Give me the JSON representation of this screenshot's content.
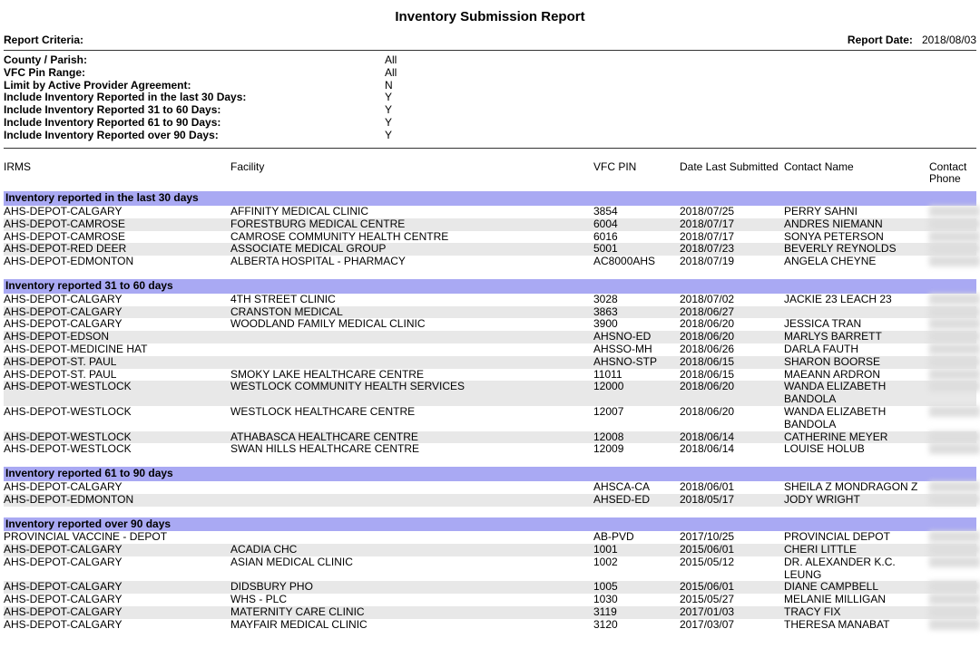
{
  "title": "Inventory Submission Report",
  "report_criteria_label": "Report Criteria:",
  "report_date_label": "Report Date:",
  "report_date": "2018/08/03",
  "criteria": [
    {
      "label": "County / Parish:",
      "value": "All"
    },
    {
      "label": "VFC Pin Range:",
      "value": "All"
    },
    {
      "label": "Limit by Active Provider Agreement:",
      "value": "N"
    },
    {
      "label": "Include Inventory Reported in the last 30 Days:",
      "value": "Y"
    },
    {
      "label": "Include Inventory Reported 31 to 60 Days:",
      "value": "Y"
    },
    {
      "label": "Include Inventory Reported 61 to 90 Days:",
      "value": "Y"
    },
    {
      "label": "Include Inventory Reported over 90 Days:",
      "value": "Y"
    }
  ],
  "columns": {
    "irms": "IRMS",
    "facility": "Facility",
    "vfc_pin": "VFC PIN",
    "date_last": "Date Last Submitted",
    "contact_name": "Contact Name",
    "contact_phone": "Contact Phone"
  },
  "groups": [
    {
      "header": "Inventory reported in the last 30 days",
      "rows": [
        {
          "irms": "AHS-DEPOT-CALGARY",
          "facility": "AFFINITY MEDICAL CLINIC",
          "pin": "3854",
          "date": "2018/07/25",
          "contact": "PERRY SAHNI"
        },
        {
          "irms": "AHS-DEPOT-CAMROSE",
          "facility": "FORESTBURG MEDICAL CENTRE",
          "pin": "6004",
          "date": "2018/07/17",
          "contact": "ANDRES NIEMANN"
        },
        {
          "irms": "AHS-DEPOT-CAMROSE",
          "facility": "CAMROSE COMMUNITY HEALTH CENTRE",
          "pin": "6016",
          "date": "2018/07/17",
          "contact": "SONYA PETERSON"
        },
        {
          "irms": "AHS-DEPOT-RED DEER",
          "facility": "ASSOCIATE MEDICAL GROUP",
          "pin": "5001",
          "date": "2018/07/23",
          "contact": "BEVERLY REYNOLDS"
        },
        {
          "irms": "AHS-DEPOT-EDMONTON",
          "facility": "ALBERTA HOSPITAL - PHARMACY",
          "pin": "AC8000AHS",
          "date": "2018/07/19",
          "contact": "ANGELA CHEYNE"
        }
      ]
    },
    {
      "header": "Inventory reported 31 to 60 days",
      "rows": [
        {
          "irms": "AHS-DEPOT-CALGARY",
          "facility": "4TH STREET CLINIC",
          "pin": "3028",
          "date": "2018/07/02",
          "contact": "JACKIE 23 LEACH 23"
        },
        {
          "irms": "AHS-DEPOT-CALGARY",
          "facility": "CRANSTON MEDICAL",
          "pin": "3863",
          "date": "2018/06/27",
          "contact": ""
        },
        {
          "irms": "AHS-DEPOT-CALGARY",
          "facility": "WOODLAND FAMILY MEDICAL CLINIC",
          "pin": "3900",
          "date": "2018/06/20",
          "contact": "JESSICA TRAN"
        },
        {
          "irms": "AHS-DEPOT-EDSON",
          "facility": "",
          "pin": "AHSNO-ED",
          "date": "2018/06/20",
          "contact": "MARLYS BARRETT"
        },
        {
          "irms": "AHS-DEPOT-MEDICINE HAT",
          "facility": "",
          "pin": "AHSSO-MH",
          "date": "2018/06/26",
          "contact": "DARLA FAUTH"
        },
        {
          "irms": "AHS-DEPOT-ST. PAUL",
          "facility": "",
          "pin": "AHSNO-STP",
          "date": "2018/06/15",
          "contact": "SHARON BOORSE"
        },
        {
          "irms": "AHS-DEPOT-ST. PAUL",
          "facility": "SMOKY LAKE HEALTHCARE CENTRE",
          "pin": "11011",
          "date": "2018/06/15",
          "contact": "MAEANN ARDRON"
        },
        {
          "irms": "AHS-DEPOT-WESTLOCK",
          "facility": "WESTLOCK COMMUNITY HEALTH SERVICES",
          "pin": "12000",
          "date": "2018/06/20",
          "contact": "WANDA ELIZABETH BANDOLA"
        },
        {
          "irms": "AHS-DEPOT-WESTLOCK",
          "facility": "WESTLOCK HEALTHCARE CENTRE",
          "pin": "12007",
          "date": "2018/06/20",
          "contact": "WANDA ELIZABETH BANDOLA"
        },
        {
          "irms": "AHS-DEPOT-WESTLOCK",
          "facility": "ATHABASCA HEALTHCARE CENTRE",
          "pin": "12008",
          "date": "2018/06/14",
          "contact": "CATHERINE MEYER"
        },
        {
          "irms": "AHS-DEPOT-WESTLOCK",
          "facility": "SWAN HILLS HEALTHCARE CENTRE",
          "pin": "12009",
          "date": "2018/06/14",
          "contact": "LOUISE HOLUB"
        }
      ]
    },
    {
      "header": "Inventory reported 61 to 90 days",
      "rows": [
        {
          "irms": "AHS-DEPOT-CALGARY",
          "facility": "",
          "pin": "AHSCA-CA",
          "date": "2018/06/01",
          "contact": "SHEILA Z MONDRAGON Z"
        },
        {
          "irms": "AHS-DEPOT-EDMONTON",
          "facility": "",
          "pin": "AHSED-ED",
          "date": "2018/05/17",
          "contact": "JODY WRIGHT"
        }
      ]
    },
    {
      "header": "Inventory reported over 90 days",
      "rows": [
        {
          "irms": "PROVINCIAL VACCINE - DEPOT",
          "facility": "",
          "pin": "AB-PVD",
          "date": "2017/10/25",
          "contact": "PROVINCIAL DEPOT"
        },
        {
          "irms": "AHS-DEPOT-CALGARY",
          "facility": "ACADIA CHC",
          "pin": "1001",
          "date": "2015/06/01",
          "contact": "CHERI LITTLE"
        },
        {
          "irms": "AHS-DEPOT-CALGARY",
          "facility": "ASIAN MEDICAL CLINIC",
          "pin": "1002",
          "date": "2015/05/12",
          "contact": "DR. ALEXANDER K.C. LEUNG"
        },
        {
          "irms": "AHS-DEPOT-CALGARY",
          "facility": "DIDSBURY PHO",
          "pin": "1005",
          "date": "2015/06/01",
          "contact": "DIANE CAMPBELL"
        },
        {
          "irms": "AHS-DEPOT-CALGARY",
          "facility": "WHS - PLC",
          "pin": "1030",
          "date": "2015/05/27",
          "contact": "MELANIE MILLIGAN"
        },
        {
          "irms": "AHS-DEPOT-CALGARY",
          "facility": "MATERNITY CARE CLINIC",
          "pin": "3119",
          "date": "2017/01/03",
          "contact": "TRACY FIX"
        },
        {
          "irms": "AHS-DEPOT-CALGARY",
          "facility": "MAYFAIR MEDICAL CLINIC",
          "pin": "3120",
          "date": "2017/03/07",
          "contact": "THERESA MANABAT"
        }
      ]
    }
  ]
}
